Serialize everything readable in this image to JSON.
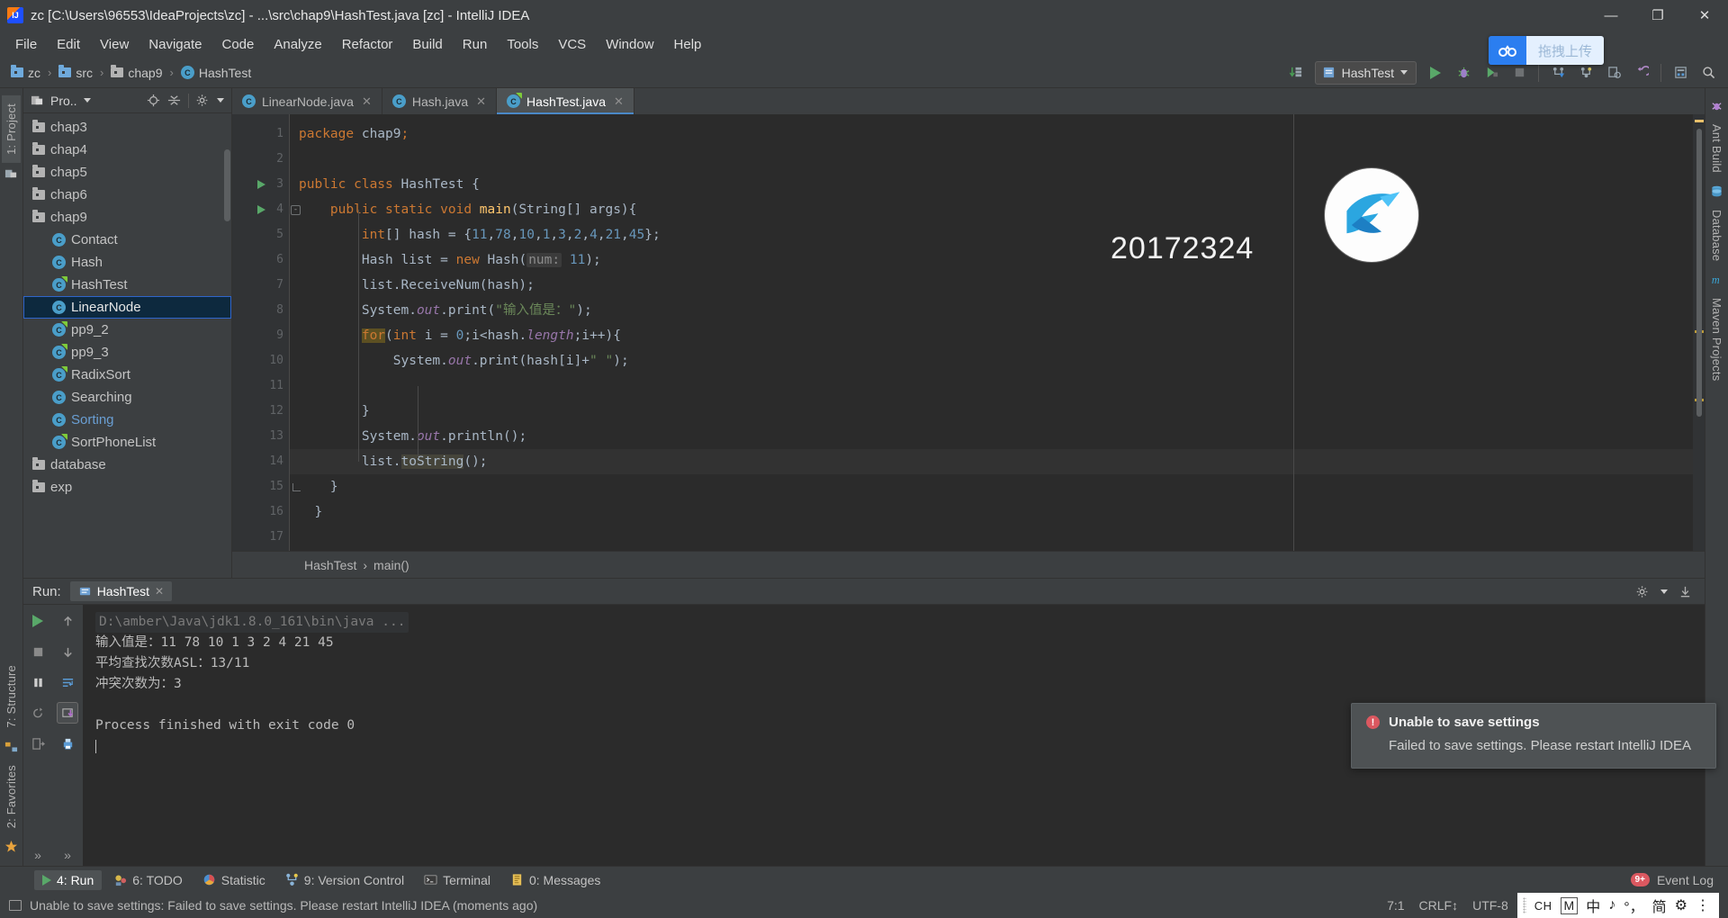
{
  "window": {
    "title": "zc [C:\\Users\\96553\\IdeaProjects\\zc] - ...\\src\\chap9\\HashTest.java [zc] - IntelliJ IDEA",
    "minimize": "—",
    "maximize": "❐",
    "close": "✕"
  },
  "menubar": {
    "items": [
      {
        "label": "File"
      },
      {
        "label": "Edit"
      },
      {
        "label": "View"
      },
      {
        "label": "Navigate"
      },
      {
        "label": "Code"
      },
      {
        "label": "Analyze"
      },
      {
        "label": "Refactor"
      },
      {
        "label": "Build"
      },
      {
        "label": "Run"
      },
      {
        "label": "Tools"
      },
      {
        "label": "VCS"
      },
      {
        "label": "Window"
      },
      {
        "label": "Help"
      }
    ]
  },
  "netdisk": {
    "label": "拖拽上传"
  },
  "navbar": {
    "crumbs": [
      {
        "label": "zc",
        "icon": "project-folder-icon"
      },
      {
        "label": "src",
        "icon": "folder-icon"
      },
      {
        "label": "chap9",
        "icon": "folder-icon"
      },
      {
        "label": "HashTest",
        "icon": "class-icon"
      }
    ],
    "separator": "›",
    "run_config": "HashTest"
  },
  "project_panel": {
    "title": "Pro..",
    "tree": [
      {
        "label": "chap3",
        "type": "folder",
        "indent": 0,
        "selected": false
      },
      {
        "label": "chap4",
        "type": "folder",
        "indent": 0,
        "selected": false
      },
      {
        "label": "chap5",
        "type": "folder",
        "indent": 0,
        "selected": false
      },
      {
        "label": "chap6",
        "type": "folder",
        "indent": 0,
        "selected": false
      },
      {
        "label": "chap9",
        "type": "folder",
        "indent": 0,
        "selected": false
      },
      {
        "label": "Contact",
        "type": "class",
        "indent": 1,
        "selected": false
      },
      {
        "label": "Hash",
        "type": "class",
        "indent": 1,
        "selected": false
      },
      {
        "label": "HashTest",
        "type": "class-runnable",
        "indent": 1,
        "selected": false
      },
      {
        "label": "LinearNode",
        "type": "class",
        "indent": 1,
        "selected": true
      },
      {
        "label": "pp9_2",
        "type": "class-runnable",
        "indent": 1,
        "selected": false
      },
      {
        "label": "pp9_3",
        "type": "class-runnable",
        "indent": 1,
        "selected": false
      },
      {
        "label": "RadixSort",
        "type": "class-runnable",
        "indent": 1,
        "selected": false
      },
      {
        "label": "Searching",
        "type": "class",
        "indent": 1,
        "selected": false
      },
      {
        "label": "Sorting",
        "type": "class",
        "indent": 1,
        "selected": false,
        "blue": true
      },
      {
        "label": "SortPhoneList",
        "type": "class-runnable",
        "indent": 1,
        "selected": false
      },
      {
        "label": "database",
        "type": "folder",
        "indent": 0,
        "selected": false
      },
      {
        "label": "exp",
        "type": "folder",
        "indent": 0,
        "selected": false
      }
    ]
  },
  "left_strip": {
    "project_tab": "1: Project",
    "structure_tab": "7: Structure",
    "favorites_tab": "2: Favorites"
  },
  "right_strip": {
    "tabs": [
      "Ant Build",
      "Database",
      "Maven Projects"
    ]
  },
  "editor": {
    "tabs": [
      {
        "label": "LinearNode.java",
        "active": false,
        "runnable": false
      },
      {
        "label": "Hash.java",
        "active": false,
        "runnable": false
      },
      {
        "label": "HashTest.java",
        "active": true,
        "runnable": true
      }
    ],
    "close_glyph": "✕",
    "line_numbers": [
      "1",
      "2",
      "3",
      "4",
      "5",
      "6",
      "7",
      "8",
      "9",
      "10",
      "11",
      "12",
      "13",
      "14",
      "15",
      "16",
      "17"
    ],
    "code_lines": [
      "package chap9;",
      "",
      "public class HashTest {",
      "    public static void main(String[] args){",
      "        int[] hash = {11,78,10,1,3,2,4,21,45};",
      "        Hash list = new Hash( num: 11);",
      "        list.ReceiveNum(hash);",
      "        System.out.print(\"输入值是：\");",
      "        for(int i = 0;i<hash.length;i++){",
      "            System.out.print(hash[i]+\" \");",
      "",
      "        }",
      "        System.out.println();",
      "        list.toString();",
      "    }",
      "  }",
      ""
    ],
    "param_hint": "num:",
    "watermark_number": "20172324",
    "breadcrumb": [
      "HashTest",
      "main()"
    ],
    "breadcrumb_sep": "›"
  },
  "run_panel": {
    "label": "Run:",
    "tab": "HashTest",
    "close_glyph": "✕",
    "console": [
      {
        "text": "D:\\amber\\Java\\jdk1.8.0_161\\bin\\java ...",
        "style": "cmd"
      },
      {
        "text": "输入值是：11 78 10 1 3 2 4 21 45",
        "style": "normal"
      },
      {
        "text": "平均查找次数ASL：13/11",
        "style": "normal"
      },
      {
        "text": "冲突次数为：3",
        "style": "normal"
      },
      {
        "text": "",
        "style": "normal"
      },
      {
        "text": "Process finished with exit code 0",
        "style": "normal"
      }
    ]
  },
  "notification": {
    "title": "Unable to save settings",
    "message": "Failed to save settings. Please restart IntelliJ IDEA",
    "icon": "error-icon",
    "accent": "#db5860"
  },
  "tool_tabs": {
    "items": [
      {
        "label": "4: Run",
        "active": true,
        "icon": "run-icon"
      },
      {
        "label": "6: TODO",
        "active": false,
        "icon": "todo-icon"
      },
      {
        "label": "Statistic",
        "active": false,
        "icon": "statistic-icon"
      },
      {
        "label": "9: Version Control",
        "active": false,
        "icon": "vcs-icon"
      },
      {
        "label": "Terminal",
        "active": false,
        "icon": "terminal-icon"
      },
      {
        "label": "0: Messages",
        "active": false,
        "icon": "messages-icon"
      }
    ],
    "event_log": "Event Log",
    "event_badge": "9+"
  },
  "statusbar": {
    "message": "Unable to save settings: Failed to save settings. Please restart IntelliJ IDEA (moments ago)",
    "caret_position": "7:1",
    "line_separator": "CRLF",
    "encoding": "UTF-8",
    "ime": {
      "lang": "CH",
      "mode_box": "M",
      "chinese": "中",
      "note": "♪",
      "punct": "°，",
      "simplified": "简",
      "tool": "⚙",
      "more": "⋮"
    }
  },
  "colors": {
    "accent_blue": "#4a88c7",
    "selection": "#0d293e",
    "error": "#db5860",
    "green_run": "#59a869",
    "keyword": "#cc7832",
    "string": "#6a8759",
    "number": "#6897bb",
    "field": "#9876aa"
  }
}
